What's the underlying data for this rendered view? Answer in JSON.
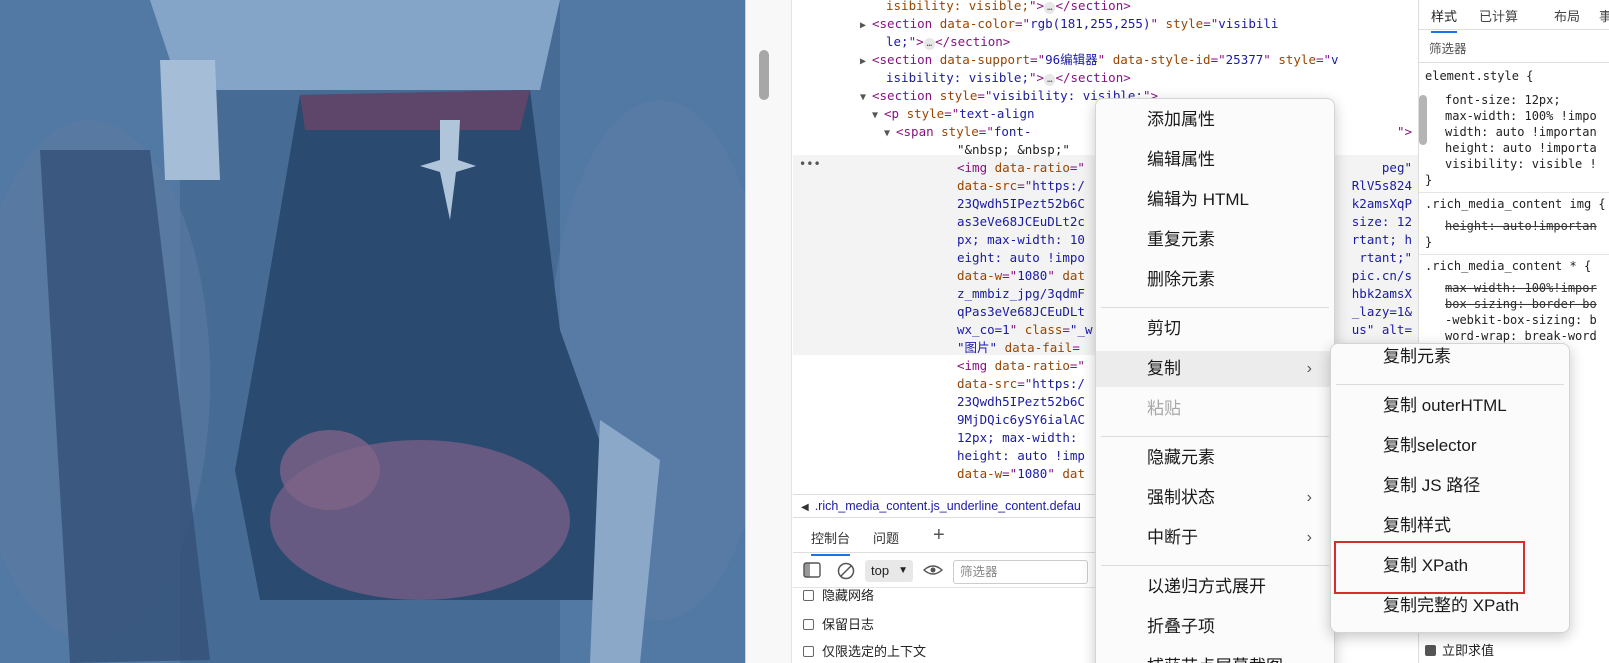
{
  "elements": {
    "lines": [
      {
        "parts": [
          [
            "attr",
            "isibility: visible;"
          ],
          [
            "tag",
            "\">"
          ],
          [
            "ell",
            "…"
          ],
          [
            "tag",
            "</section>"
          ]
        ]
      },
      {
        "tri": "▶",
        "parts": [
          [
            "tag",
            "<section "
          ],
          [
            "attr",
            "data-color"
          ],
          [
            "tag",
            "=\""
          ],
          [
            "val",
            "rgb(181,255,255)"
          ],
          [
            "tag",
            "\" "
          ],
          [
            "attr",
            "style"
          ],
          [
            "tag",
            "=\""
          ],
          [
            "val",
            "visibili"
          ]
        ]
      },
      {
        "parts": [
          [
            "val",
            "le;"
          ],
          [
            "tag",
            "\">"
          ],
          [
            "ell",
            "…"
          ],
          [
            "tag",
            "</section>"
          ]
        ]
      },
      {
        "tri": "▶",
        "parts": [
          [
            "tag",
            "<section "
          ],
          [
            "attr",
            "data-support"
          ],
          [
            "tag",
            "=\""
          ],
          [
            "val",
            "96编辑器"
          ],
          [
            "tag",
            "\" "
          ],
          [
            "attr",
            "data-style-id"
          ],
          [
            "tag",
            "=\""
          ],
          [
            "val",
            "25377"
          ],
          [
            "tag",
            "\" "
          ],
          [
            "attr",
            "style"
          ],
          [
            "tag",
            "=\""
          ],
          [
            "val",
            "v"
          ]
        ]
      },
      {
        "parts": [
          [
            "val",
            "isibility: visible;"
          ],
          [
            "tag",
            "\">"
          ],
          [
            "ell",
            "…"
          ],
          [
            "tag",
            "</section>"
          ]
        ]
      },
      {
        "tri": "▼",
        "parts": [
          [
            "tag",
            "<section "
          ],
          [
            "attr",
            "style"
          ],
          [
            "tag",
            "=\""
          ],
          [
            "val",
            "visibility: visible;"
          ],
          [
            "tag",
            "\">"
          ]
        ]
      },
      {
        "tri": "▼",
        "parts": [
          [
            "tag",
            "<p "
          ],
          [
            "attr",
            "style"
          ],
          [
            "tag",
            "=\""
          ],
          [
            "val",
            "text-align"
          ]
        ]
      },
      {
        "tri": "▼",
        "parts": [
          [
            "tag",
            "<span "
          ],
          [
            "attr",
            "style"
          ],
          [
            "tag",
            "=\""
          ],
          [
            "val",
            "font-"
          ]
        ]
      },
      {
        "parts": [
          [
            "text",
            "\"&nbsp; &nbsp;\""
          ]
        ]
      },
      {
        "parts": [
          [
            "tag",
            "<img "
          ],
          [
            "attr",
            "data-ratio"
          ],
          [
            "tag",
            "=\""
          ]
        ]
      },
      {
        "parts": [
          [
            "attr",
            "data-src"
          ],
          [
            "tag",
            "=\""
          ],
          [
            "val",
            "https:/"
          ]
        ]
      },
      {
        "parts": [
          [
            "val",
            "23Qwdh5IPezt52b6C"
          ]
        ]
      },
      {
        "parts": [
          [
            "val",
            "as3eVe68JCEuDLt2c"
          ]
        ]
      },
      {
        "parts": [
          [
            "val",
            "px; max-width: 10"
          ]
        ]
      },
      {
        "parts": [
          [
            "val",
            "eight: auto !impo"
          ]
        ]
      },
      {
        "parts": [
          [
            "attr",
            "data-w"
          ],
          [
            "tag",
            "=\""
          ],
          [
            "val",
            "1080"
          ],
          [
            "tag",
            "\" "
          ],
          [
            "attr",
            "dat"
          ]
        ]
      },
      {
        "parts": [
          [
            "val",
            "z_mmbiz_jpg/3qdmF"
          ]
        ]
      },
      {
        "parts": [
          [
            "val",
            "qPas3eVe68JCEuDLt"
          ]
        ]
      },
      {
        "parts": [
          [
            "val",
            "wx_co=1"
          ],
          [
            "tag",
            "\" "
          ],
          [
            "attr",
            "class"
          ],
          [
            "tag",
            "="
          ],
          [
            "val",
            "\"_w"
          ]
        ]
      },
      {
        "parts": [
          [
            "val",
            "\"图片\""
          ],
          [
            "tag",
            " "
          ],
          [
            "attr",
            "data-fail"
          ],
          [
            "tag",
            "="
          ]
        ]
      },
      {
        "parts": [
          [
            "tag",
            "<img "
          ],
          [
            "attr",
            "data-ratio"
          ],
          [
            "tag",
            "=\""
          ]
        ]
      },
      {
        "parts": [
          [
            "attr",
            "data-src"
          ],
          [
            "tag",
            "=\""
          ],
          [
            "val",
            "https:/"
          ]
        ]
      },
      {
        "parts": [
          [
            "val",
            "23Qwdh5IPezt52b6C"
          ]
        ]
      },
      {
        "parts": [
          [
            "val",
            "9MjDQic6ySY6ialAC"
          ]
        ]
      },
      {
        "parts": [
          [
            "val",
            "12px; max-width:"
          ]
        ]
      },
      {
        "parts": [
          [
            "val",
            "height: auto !imp"
          ]
        ]
      },
      {
        "parts": [
          [
            "attr",
            "data-w"
          ],
          [
            "tag",
            "=\""
          ],
          [
            "val",
            "1080"
          ],
          [
            "tag",
            "\" "
          ],
          [
            "attr",
            "dat"
          ]
        ]
      }
    ],
    "right_fragments": [
      {
        "text": "\">",
        "row": 7
      },
      {
        "text": "peg\"",
        "row": 9
      },
      {
        "text": "RlV5s824",
        "row": 10
      },
      {
        "text": "k2amsXqP",
        "row": 11
      },
      {
        "text": "size: 12",
        "row": 12
      },
      {
        "text": "rtant; h",
        "row": 13
      },
      {
        "text": "rtant;\"",
        "row": 14
      },
      {
        "text": "pic.cn/s",
        "row": 15
      },
      {
        "text": "hbk2amsX",
        "row": 16
      },
      {
        "text": "_lazy=1&",
        "row": 17
      },
      {
        "text": "us\" alt=",
        "row": 18
      }
    ],
    "more_dots": "•••"
  },
  "breadcrumb": {
    "arrow": "◀",
    "text": ".rich_media_content.js_underline_content.defau"
  },
  "drawer": {
    "tabs": [
      "控制台",
      "问题"
    ],
    "add_tab": "+",
    "context": "top",
    "filter_placeholder": "筛选器",
    "checkboxes": [
      "隐藏网络",
      "保留日志",
      "仅限选定的上下文"
    ]
  },
  "styles": {
    "tabs": [
      "样式",
      "已计算",
      "布局",
      "事"
    ],
    "filter_placeholder": "筛选器",
    "rules": [
      {
        "selector": "element.style {",
        "props": [
          "font-size: 12px;",
          "max-width: 100% !impo",
          "width: auto !importan",
          "height: auto !importa",
          "visibility: visible !"
        ],
        "struck": [],
        "close": "}"
      },
      {
        "selector": ".rich_media_content img {",
        "props": [
          "height: auto!importan"
        ],
        "struck": [
          0
        ],
        "close": "}"
      },
      {
        "selector": ".rich_media_content * {",
        "props": [
          "max-width: 100%!impor",
          "box-sizing: border-bo",
          "-webkit-box-sizing: b",
          "word-wrap: break-word"
        ],
        "struck": [
          0,
          1
        ],
        "close": ""
      }
    ],
    "immediate_label": "立即求值"
  },
  "context_menu": {
    "items": [
      {
        "label": "添加属性"
      },
      {
        "label": "编辑属性"
      },
      {
        "label": "编辑为 HTML"
      },
      {
        "label": "重复元素"
      },
      {
        "label": "删除元素"
      },
      {
        "sep": true
      },
      {
        "label": "剪切"
      },
      {
        "label": "复制",
        "submenu": true,
        "highlight": true
      },
      {
        "label": "粘贴",
        "disabled": true
      },
      {
        "sep": true
      },
      {
        "label": "隐藏元素"
      },
      {
        "label": "强制状态",
        "submenu": true
      },
      {
        "label": "中断于",
        "submenu": true
      },
      {
        "sep": true
      },
      {
        "label": "以递归方式展开"
      },
      {
        "label": "折叠子项"
      },
      {
        "label": "捕获节点屏幕截图"
      }
    ]
  },
  "copy_submenu": {
    "items": [
      {
        "label": "复制元素"
      },
      {
        "sep": true
      },
      {
        "label": "复制 outerHTML"
      },
      {
        "label": "复制selector"
      },
      {
        "label": "复制 JS 路径"
      },
      {
        "label": "复制样式"
      },
      {
        "label": "复制 XPath",
        "outlined": true
      },
      {
        "label": "复制完整的 XPath"
      }
    ]
  },
  "colors": {
    "highlight_outline": "#d32f2f",
    "devtools_accent": "#1a73e8",
    "photo_tint": "#3a5a80"
  },
  "icons": {
    "submenu_arrow": "chevron-right-icon",
    "sidebar_toggle": "sidebar-icon",
    "clear_console": "clear-icon",
    "live_expression": "eye-icon",
    "checkbox": "checkbox-icon"
  }
}
